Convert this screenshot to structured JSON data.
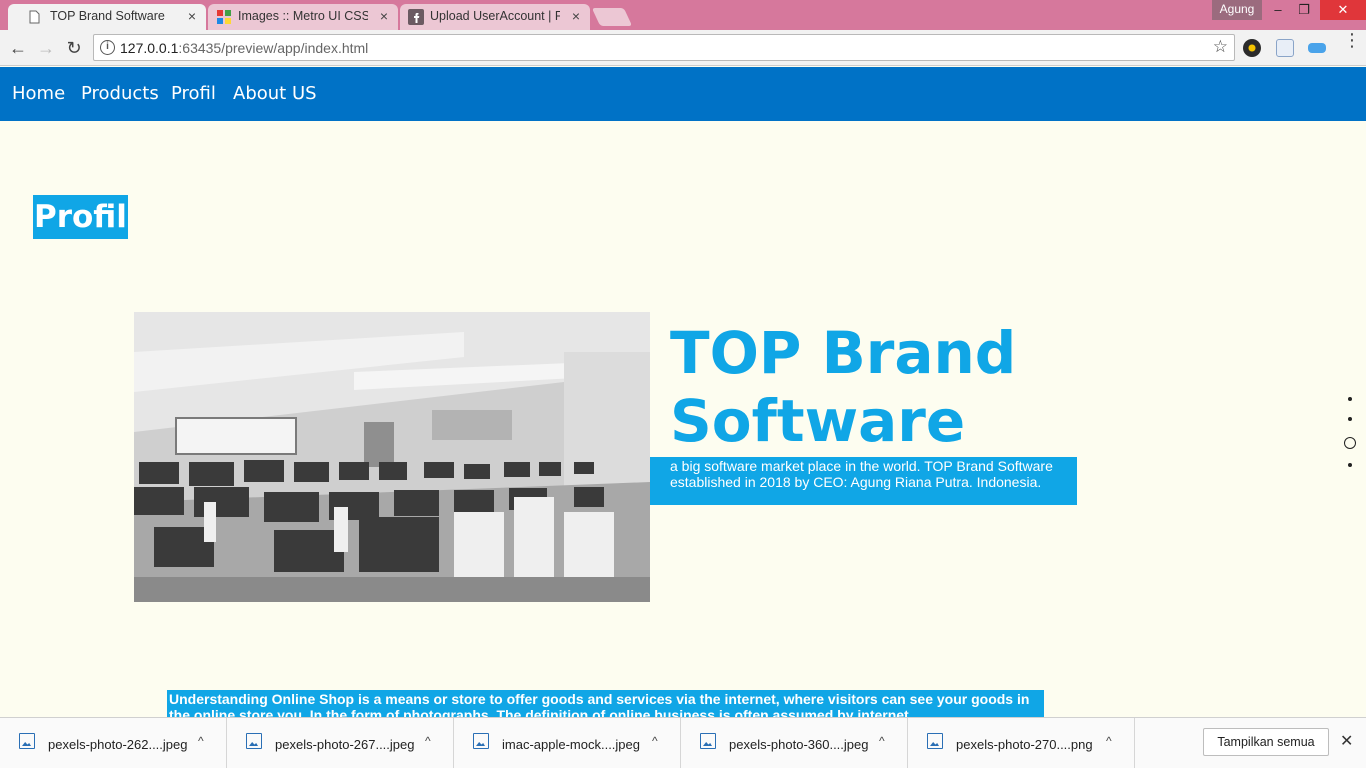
{
  "browser": {
    "tabs": [
      {
        "title": "TOP Brand Software",
        "active": true
      },
      {
        "title": "Images :: Metro UI CSS -",
        "active": false
      },
      {
        "title": "Upload UserAccount | Fa",
        "active": false
      }
    ],
    "close_glyph": "×",
    "profile_name": "Agung",
    "window_buttons": {
      "minimize": "–",
      "restore": "❐",
      "close": "✕"
    },
    "nav": {
      "back": "←",
      "forward": "→",
      "reload": "↻"
    },
    "url_host": "127.0.0.1",
    "url_rest": ":63435/preview/app/index.html",
    "star": "☆",
    "menu": "⋮"
  },
  "site": {
    "nav": [
      "Home",
      "Products",
      "Profil",
      "About US"
    ],
    "section_title": "Profil",
    "brand_heading": "TOP Brand Software",
    "brand_description": "a big software market place in the world. TOP Brand Software established in 2018 by CEO: Agung Riana Putra. Indonesia.",
    "understanding_text": "Understanding Online Shop is a means or store to offer goods and services via the internet, where visitors can see your goods in the online store you. In the form of photographs. The definition of online business is often assumed by internet"
  },
  "downloads": {
    "items": [
      {
        "name": "pexels-photo-262....jpeg"
      },
      {
        "name": "pexels-photo-267....jpeg"
      },
      {
        "name": "imac-apple-mock....jpeg"
      },
      {
        "name": "pexels-photo-360....jpeg"
      },
      {
        "name": "pexels-photo-270....png"
      }
    ],
    "chevron": "^",
    "show_all": "Tampilkan semua",
    "close": "✕"
  },
  "colors": {
    "tabstrip": "#d6789c",
    "site_nav": "#0072c6",
    "accent": "#10a6e6",
    "page_bg": "#fdfdf0"
  }
}
